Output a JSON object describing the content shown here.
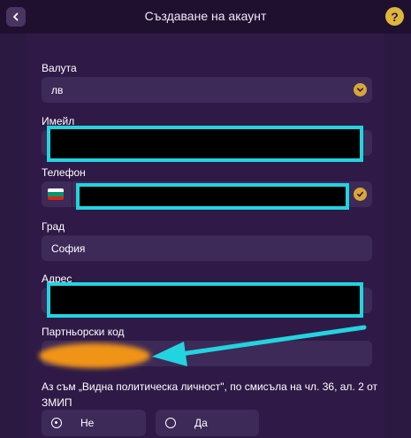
{
  "header": {
    "title": "Създаване на акаунт",
    "help_glyph": "?"
  },
  "form": {
    "currency": {
      "label": "Валута",
      "value": "лв"
    },
    "email": {
      "label": "Имейл",
      "value": ""
    },
    "phone": {
      "label": "Телефон",
      "value": "",
      "flag": "bulgaria-flag"
    },
    "city": {
      "label": "Град",
      "value": "София"
    },
    "address": {
      "label": "Адрес",
      "value": ""
    },
    "partner_code": {
      "label": "Партньорски код",
      "value": ""
    },
    "pep": {
      "question": "Аз съм „Видна политическа личност\", по смисъла на чл. 36, ал. 2 от ЗМИП",
      "options": [
        {
          "label": "Не",
          "selected": true
        },
        {
          "label": "Да",
          "selected": false
        }
      ]
    }
  },
  "colors": {
    "background": "#2a1740",
    "field": "#3d2a58",
    "accent": "#d8a636",
    "redaction_border": "#22d4e0",
    "annotation_arrow": "#22d4e0",
    "annotation_blur": "#f09418"
  }
}
